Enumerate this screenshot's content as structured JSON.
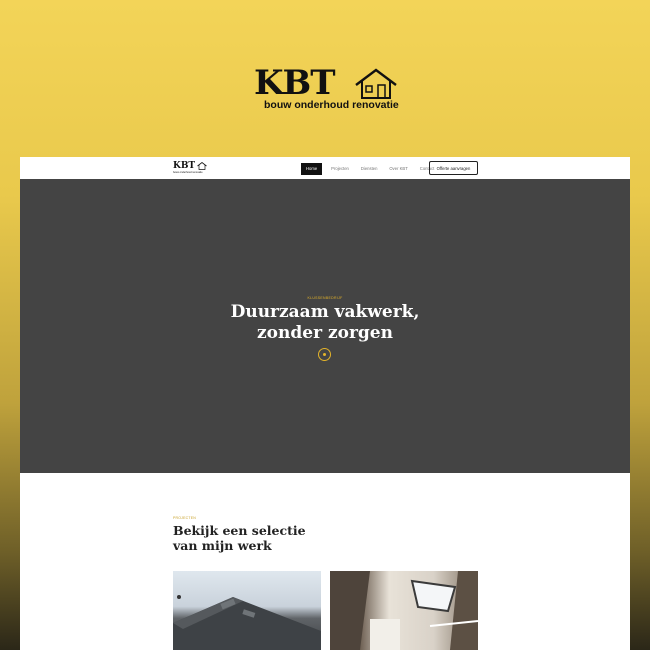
{
  "brand": {
    "wordmark": "KBT",
    "tagline": "bouw onderhoud renovatie"
  },
  "nav": {
    "logo_wordmark": "KBT",
    "logo_tagline": "bouw onderhoud renovatie",
    "links": [
      "Home",
      "Projecten",
      "Diensten",
      "Over KBT",
      "Contact"
    ],
    "cta": "Offerte aanvragen"
  },
  "hero": {
    "eyebrow": "KLUSSENBEDRIJF",
    "title_line1": "Duurzaam vakwerk,",
    "title_line2": "zonder zorgen"
  },
  "projects_section": {
    "eyebrow": "PROJECTEN",
    "title_line1": "Bekijk een selectie",
    "title_line2": "van mijn werk"
  },
  "colors": {
    "accent": "#e3b32a",
    "hero_bg": "#444444",
    "gradient_top": "#f3d458",
    "gradient_bottom": "#2b2718"
  }
}
